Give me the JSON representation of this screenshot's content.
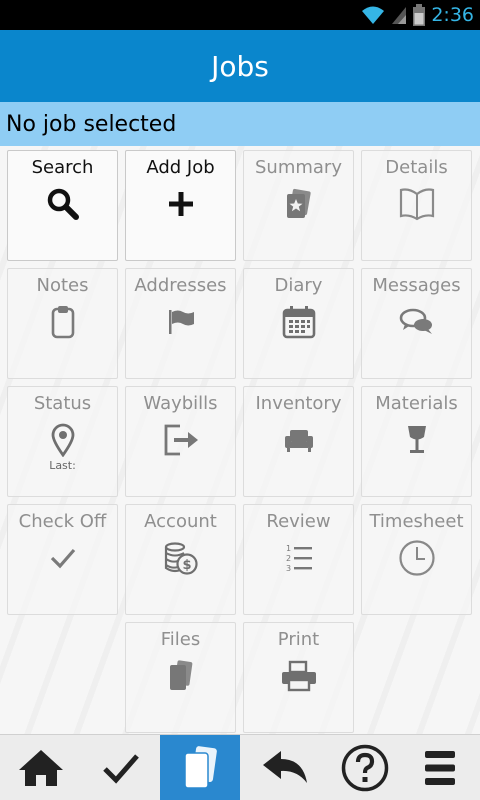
{
  "status_bar": {
    "time": "2:36",
    "icons": [
      "wifi-icon",
      "signal-icon",
      "battery-icon"
    ]
  },
  "app_bar": {
    "title": "Jobs",
    "color": "#0a86cc"
  },
  "job_bar": {
    "text": "No job selected",
    "color": "#8fcdf4"
  },
  "tiles": [
    {
      "label": "Search",
      "icon": "search-icon",
      "enabled": true
    },
    {
      "label": "Add Job",
      "icon": "plus-icon",
      "enabled": true
    },
    {
      "label": "Summary",
      "icon": "summary-icon",
      "enabled": false
    },
    {
      "label": "Details",
      "icon": "book-icon",
      "enabled": false
    },
    {
      "label": "Notes",
      "icon": "clipboard-icon",
      "enabled": false
    },
    {
      "label": "Addresses",
      "icon": "flag-icon",
      "enabled": false
    },
    {
      "label": "Diary",
      "icon": "calendar-icon",
      "enabled": false
    },
    {
      "label": "Messages",
      "icon": "chat-icon",
      "enabled": false
    },
    {
      "label": "Status",
      "icon": "location-pin-icon",
      "sublabel": "Last:",
      "enabled": false
    },
    {
      "label": "Waybills",
      "icon": "exit-arrow-icon",
      "enabled": false
    },
    {
      "label": "Inventory",
      "icon": "armchair-icon",
      "enabled": false
    },
    {
      "label": "Materials",
      "icon": "glass-icon",
      "enabled": false
    },
    {
      "label": "Check Off",
      "icon": "checkmark-icon",
      "enabled": false
    },
    {
      "label": "Account",
      "icon": "coins-icon",
      "enabled": false
    },
    {
      "label": "Review",
      "icon": "numbered-list-icon",
      "enabled": false
    },
    {
      "label": "Timesheet",
      "icon": "clock-icon",
      "enabled": false
    },
    {
      "label": "Files",
      "icon": "files-icon",
      "enabled": false
    },
    {
      "label": "Print",
      "icon": "printer-icon",
      "enabled": false
    }
  ],
  "bottom_nav": [
    {
      "icon": "home-icon",
      "active": false
    },
    {
      "icon": "checkmark-icon",
      "active": false
    },
    {
      "icon": "files-icon",
      "active": true
    },
    {
      "icon": "back-arrow-icon",
      "active": false
    },
    {
      "icon": "help-icon",
      "active": false
    },
    {
      "icon": "menu-icon",
      "active": false
    }
  ],
  "accent_active": "#2a88cf"
}
